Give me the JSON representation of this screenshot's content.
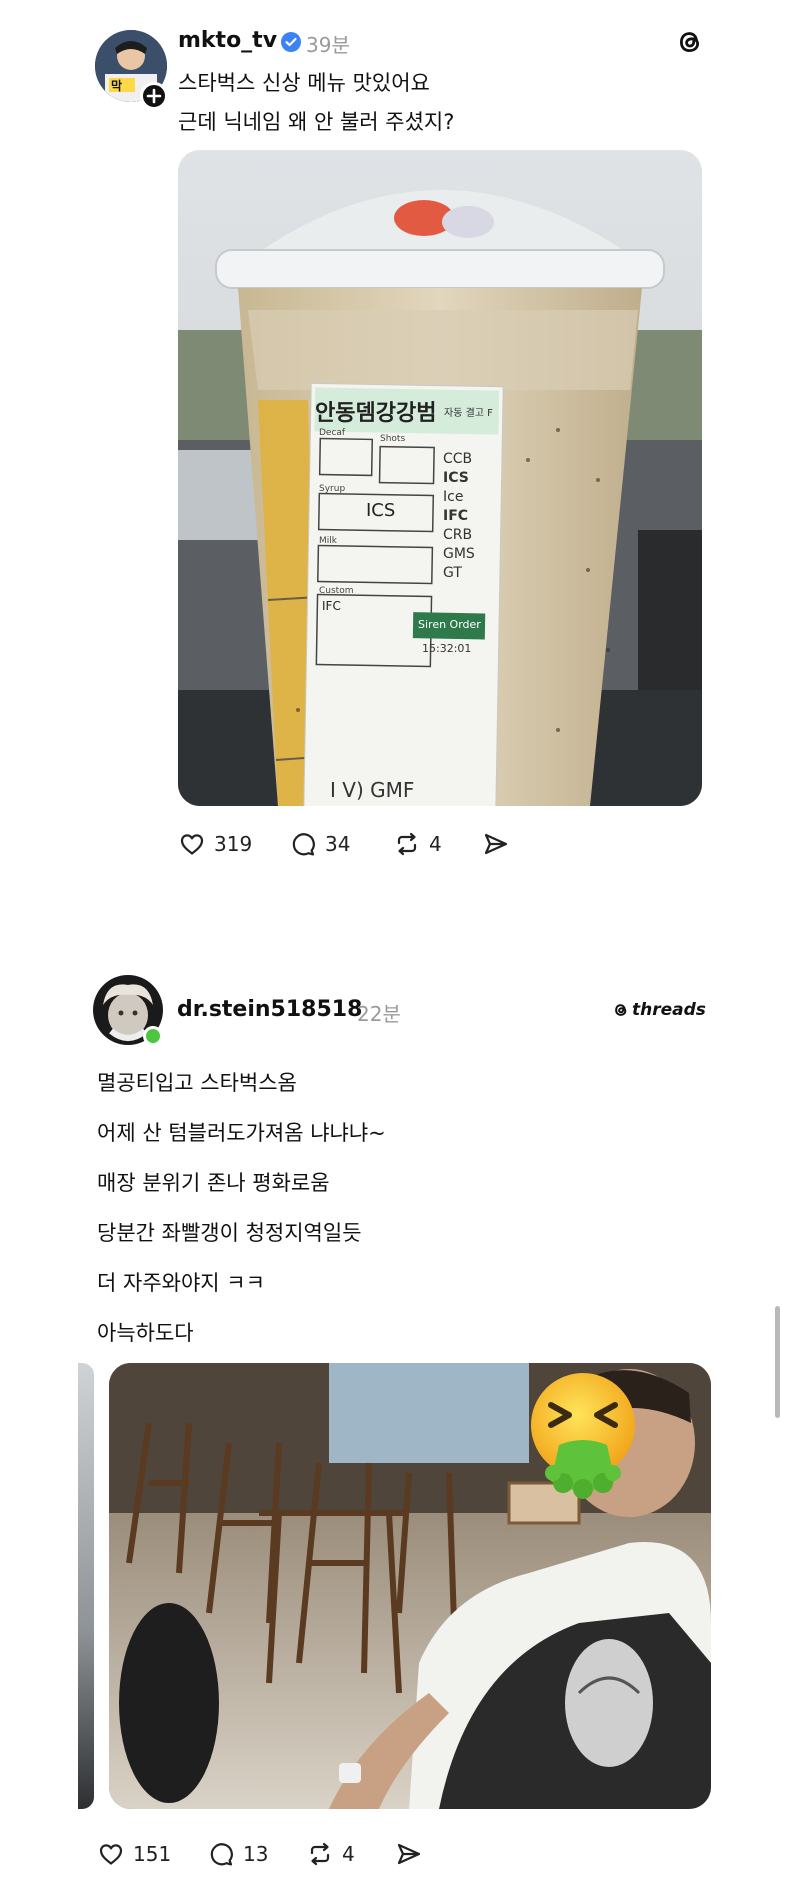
{
  "posts": [
    {
      "username": "mkto_tv",
      "time": "39분",
      "verified": true,
      "lines": [
        "스타벅스 신상 메뉴 맛있어요",
        "근데 닉네임 왜 안 불러 주셨지?"
      ],
      "photo_text": {
        "nickname": "안동뎀강강범",
        "sticker_small": "자동 결고 F",
        "decaf": "Decaf",
        "shots": "Shots",
        "syrup": "Syrup",
        "syrup_value": "ICS",
        "milk": "Milk",
        "custom": "Custom",
        "custom_value": "IFC",
        "codes": [
          "CCB",
          "ICS",
          "Ice",
          "IFC",
          "CRB",
          "GMS",
          "GT"
        ],
        "siren": "Siren Order",
        "time": "15:32:01",
        "bottom": "I V) GMF"
      },
      "actions": {
        "likes": "319",
        "comments": "34",
        "reposts": "4"
      }
    },
    {
      "username": "dr.stein518518",
      "time": "22분",
      "brand": "threads",
      "lines": [
        "멸공티입고 스타벅스옴",
        "어제 산 텀블러도가져옴 냐냐냐~",
        "매장 분위기 존나 평화로움",
        "당분간 좌빨갱이 청정지역일듯",
        "더 자주와야지 ㅋㅋ",
        "아늑하도다"
      ],
      "actions": {
        "likes": "151",
        "comments": "13",
        "reposts": "4"
      }
    }
  ],
  "icons": [
    "threads-logo-icon",
    "verified-badge-icon",
    "follow-plus-icon",
    "heart-icon",
    "comment-icon",
    "repost-icon",
    "share-icon",
    "vomit-emoji-icon"
  ],
  "colors": {
    "verified": "#3b82f6",
    "online": "#4cc63f",
    "meta": "#9a9a9a"
  }
}
